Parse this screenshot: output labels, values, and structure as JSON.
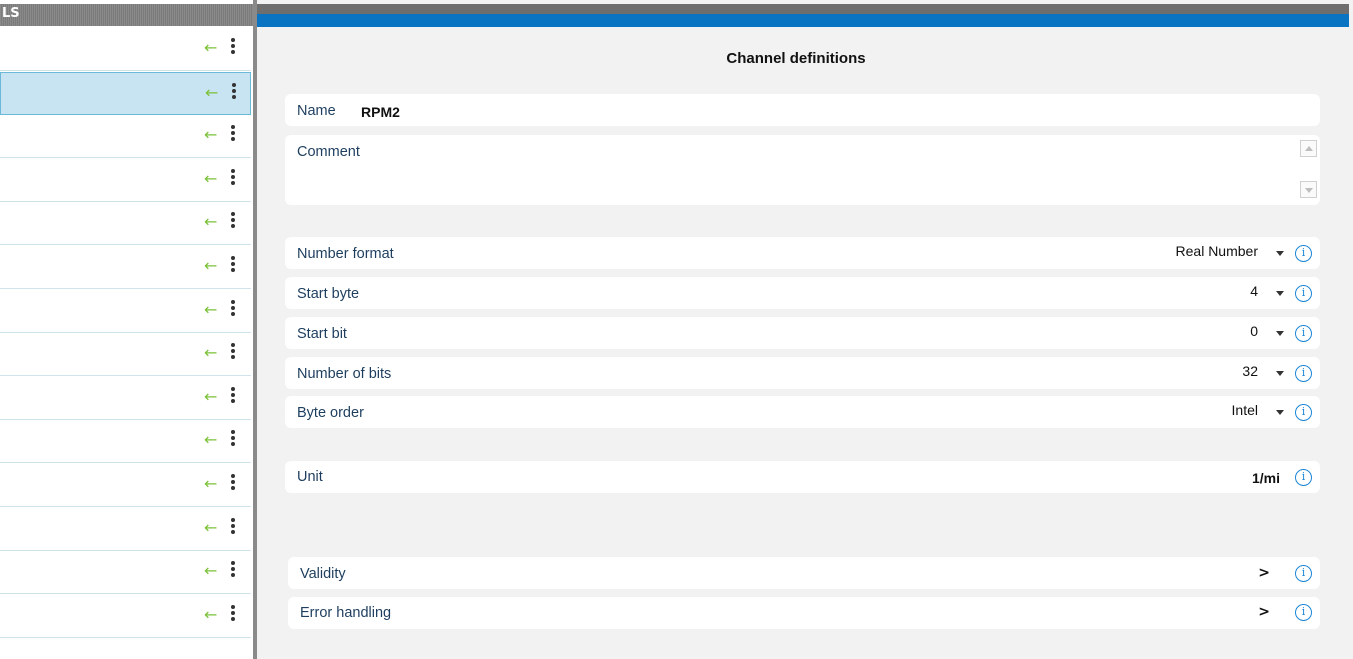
{
  "left_panel": {
    "header_text": "LS",
    "rows": [
      {
        "arrow": "←",
        "selected": false
      },
      {
        "arrow": "←",
        "selected": true
      },
      {
        "arrow": "←",
        "selected": false
      },
      {
        "arrow": "←",
        "selected": false
      },
      {
        "arrow": "←",
        "selected": false
      },
      {
        "arrow": "←",
        "selected": false
      },
      {
        "arrow": "←",
        "selected": false
      },
      {
        "arrow": "←",
        "selected": false
      },
      {
        "arrow": "←",
        "selected": false
      },
      {
        "arrow": "←",
        "selected": false
      },
      {
        "arrow": "←",
        "selected": false
      },
      {
        "arrow": "←",
        "selected": false
      },
      {
        "arrow": "←",
        "selected": false
      },
      {
        "arrow": "←",
        "selected": false
      }
    ]
  },
  "panel": {
    "title": "Channel definitions",
    "name_label": "Name",
    "name_value": "RPM2",
    "comment_label": "Comment",
    "number_format": {
      "label": "Number format",
      "value": "Real Number"
    },
    "start_byte": {
      "label": "Start byte",
      "value": "4"
    },
    "start_bit": {
      "label": "Start bit",
      "value": "0"
    },
    "number_of_bits": {
      "label": "Number of bits",
      "value": "32"
    },
    "byte_order": {
      "label": "Byte order",
      "value": "Intel"
    },
    "unit": {
      "label": "Unit",
      "value": "1/mi"
    },
    "validity": {
      "label": "Validity",
      "chevron": ">"
    },
    "error_handling": {
      "label": "Error handling",
      "chevron": ">"
    },
    "info_glyph": "i"
  },
  "colors": {
    "accent_blue": "#0a74c2",
    "arrow_green": "#7cc23a",
    "selected_row": "#c8e3f1",
    "label_text": "#1d3e5e"
  }
}
